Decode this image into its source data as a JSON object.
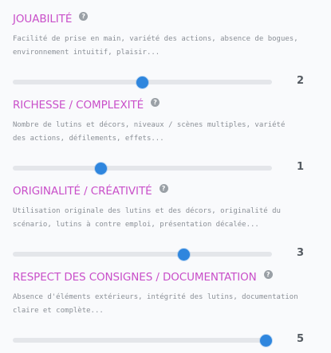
{
  "colors": {
    "title": "#c94fc9",
    "thumb": "#2f86de",
    "track": "#e4e6ea",
    "description": "#8a8f96",
    "value": "#555b62",
    "help_icon": "#9aa0a6"
  },
  "slider_range": {
    "min": 0,
    "max": 5
  },
  "criteria": [
    {
      "title": "JOUABILITÉ",
      "help_icon": "question-circle-icon",
      "description": [
        "Facilité de prise en main, variété des actions, absence de bogues,",
        "environnement intuitif, plaisir..."
      ],
      "value": 2,
      "value_label": "2",
      "fraction": 0.5
    },
    {
      "title": "RICHESSE / COMPLEXITÉ",
      "help_icon": "question-circle-icon",
      "description": [
        "Nombre de lutins et décors, niveaux / scènes multiples, variété",
        "des actions, défilements, effets..."
      ],
      "value": 1,
      "value_label": "1",
      "fraction": 0.34
    },
    {
      "title": "ORIGINALITÉ / CRÉATIVITÉ",
      "help_icon": "question-circle-icon",
      "description": [
        "Utilisation originale des lutins et des décors, originalité du",
        "scénario, lutins à contre emploi, présentation décalée..."
      ],
      "value": 3,
      "value_label": "3",
      "fraction": 0.66
    },
    {
      "title": "RESPECT DES CONSIGNES / DOCUMENTATION",
      "help_icon": "question-circle-icon",
      "description": [
        "Absence d'éléments extérieurs, intégrité des lutins, documentation",
        "claire et complète..."
      ],
      "value": 5,
      "value_label": "5",
      "fraction": 0.977
    }
  ]
}
